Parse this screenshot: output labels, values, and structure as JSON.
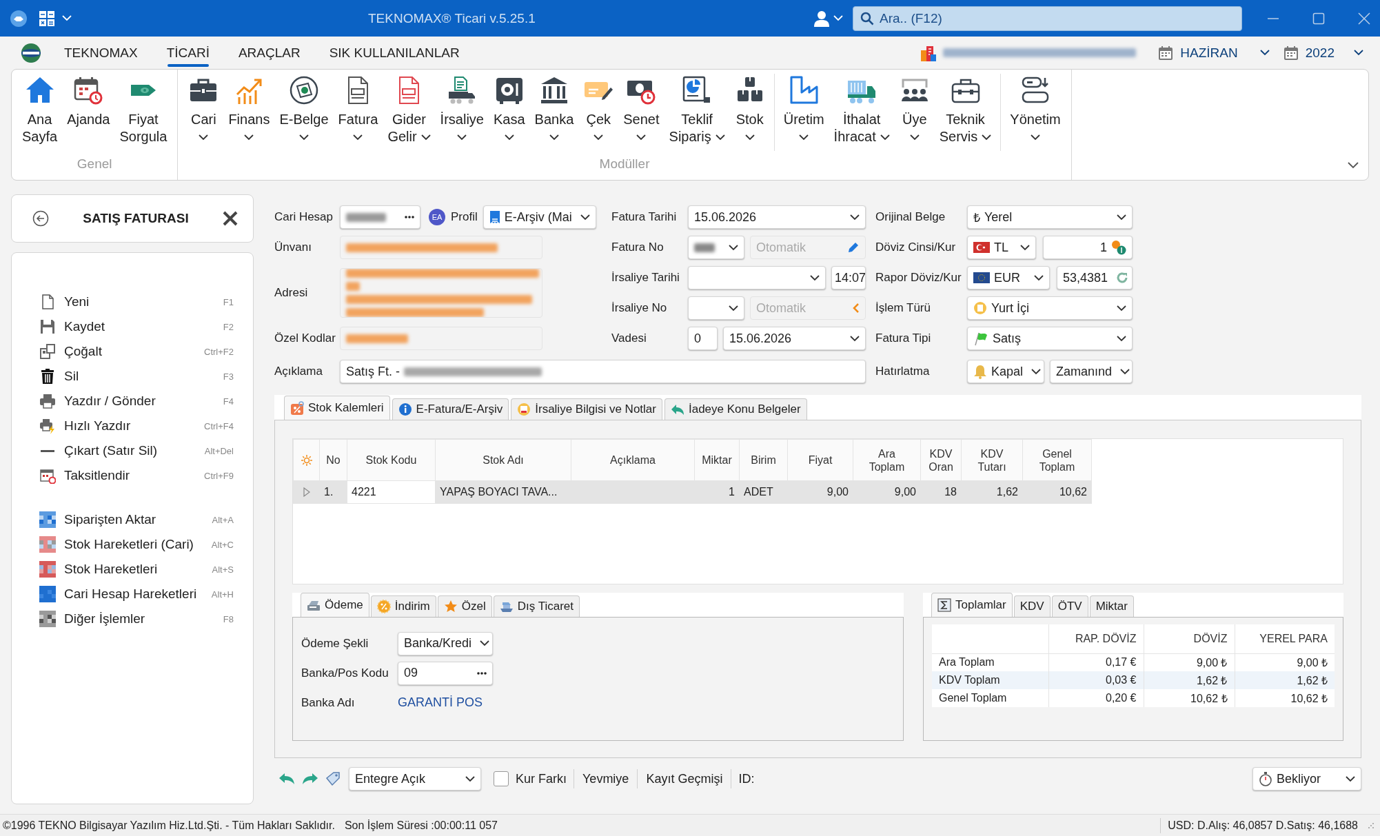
{
  "window": {
    "title": "TEKNOMAX® Ticari v.5.25.1",
    "search": {
      "placeholder": "Ara.. (F12)"
    }
  },
  "menu_tabs": [
    {
      "label": "TEKNOMAX",
      "selected": false
    },
    {
      "label": "TİCARİ",
      "selected": true
    },
    {
      "label": "ARAÇLAR",
      "selected": false
    },
    {
      "label": "SIK KULLANILANLAR",
      "selected": false
    }
  ],
  "period": {
    "company_blurred": true,
    "month": "HAZİRAN",
    "year": "2022"
  },
  "ribbon": [
    {
      "label": "Genel",
      "sections": [
        [
          {
            "label": "Ana\nSayfa",
            "dropdown": false
          },
          {
            "label": "Ajanda",
            "dropdown": false
          },
          {
            "label": "Fiyat\nSorgula",
            "dropdown": false
          }
        ]
      ]
    },
    {
      "label": "Modüller",
      "sections": [
        [
          {
            "label": "Cari",
            "dropdown": true
          },
          {
            "label": "Finans",
            "dropdown": true
          },
          {
            "label": "E-Belge",
            "dropdown": true
          },
          {
            "label": "Fatura",
            "dropdown": true
          },
          {
            "label": "Gider\nGelir",
            "dropdown": true
          },
          {
            "label": "İrsaliye",
            "dropdown": true
          },
          {
            "label": "Kasa",
            "dropdown": true
          },
          {
            "label": "Banka",
            "dropdown": true
          },
          {
            "label": "Çek",
            "dropdown": true
          },
          {
            "label": "Senet",
            "dropdown": true
          },
          {
            "label": "Teklif\nSipariş",
            "dropdown": true
          },
          {
            "label": "Stok",
            "dropdown": true
          }
        ],
        [
          {
            "label": "Üretim",
            "dropdown": true
          },
          {
            "label": "İthalat\nİhracat",
            "dropdown": true
          },
          {
            "label": "Üye",
            "dropdown": true
          },
          {
            "label": "Teknik\nServis",
            "dropdown": true
          }
        ],
        [
          {
            "label": "Yönetim",
            "dropdown": true
          }
        ]
      ]
    }
  ],
  "document": {
    "title": "SATIŞ FATURASI",
    "action_groups": [
      [
        {
          "label": "Yeni",
          "shortcut": "F1"
        },
        {
          "label": "Kaydet",
          "shortcut": "F2"
        },
        {
          "label": "Çoğalt",
          "shortcut": "Ctrl+F2"
        },
        {
          "label": "Sil",
          "shortcut": "F3"
        },
        {
          "label": "Yazdır / Gönder",
          "shortcut": "F4"
        },
        {
          "label": "Hızlı Yazdır",
          "shortcut": "Ctrl+F4"
        },
        {
          "label": "Çıkart (Satır Sil)",
          "shortcut": "Alt+Del"
        },
        {
          "label": "Taksitlendir",
          "shortcut": "Ctrl+F9"
        }
      ],
      [
        {
          "label": "Siparişten Aktar",
          "shortcut": "Alt+A"
        },
        {
          "label": "Stok Hareketleri (Cari)",
          "shortcut": "Alt+C"
        },
        {
          "label": "Stok Hareketleri",
          "shortcut": "Alt+S"
        },
        {
          "label": "Cari Hesap Hareketleri",
          "shortcut": "Alt+H"
        },
        {
          "label": "Diğer İşlemler",
          "shortcut": "F8"
        }
      ]
    ]
  },
  "form": {
    "cari_hesap": {
      "label": "Cari Hesap",
      "value_blurred": true
    },
    "profil": {
      "badge": "EA",
      "label": "Profil",
      "value": "E-Arşiv (Mai"
    },
    "unvani": {
      "label": "Ünvanı",
      "value_blurred": true
    },
    "adresi": {
      "label": "Adresi",
      "value_blurred": true
    },
    "ozel_kodlar": {
      "label": "Özel Kodlar",
      "value_blurred": true
    },
    "aciklama": {
      "label": "Açıklama",
      "value": "Satış Ft. -",
      "value_blurred": true
    },
    "fatura_tarihi": {
      "label": "Fatura Tarihi",
      "value": "15.06.2026"
    },
    "fatura_no": {
      "label": "Fatura No",
      "series_blurred": true,
      "number_placeholder": "Otomatik"
    },
    "irsaliye_tarihi": {
      "label": "İrsaliye Tarihi",
      "time": "14:07"
    },
    "irsaliye_no": {
      "label": "İrsaliye No",
      "number_placeholder": "Otomatik"
    },
    "vadesi": {
      "label": "Vadesi",
      "days": "0",
      "date": "15.06.2026"
    },
    "orijinal_belge": {
      "label": "Orijinal Belge",
      "symbol": "₺",
      "value": "Yerel"
    },
    "doviz": {
      "label": "Döviz Cinsi/Kur",
      "currency": "TL",
      "rate": "1"
    },
    "rapor_doviz": {
      "label": "Rapor Döviz/Kur",
      "currency": "EUR",
      "rate": "53,4381"
    },
    "islem_turu": {
      "label": "İşlem Türü",
      "value": "Yurt İçi"
    },
    "fatura_tipi": {
      "label": "Fatura Tipi",
      "value": "Satış"
    },
    "hatirlatma": {
      "label": "Hatırlatma",
      "value": "Kapal",
      "timing": "Zamanınd"
    }
  },
  "detail_tabs": [
    {
      "label": "Stok Kalemleri",
      "selected": true
    },
    {
      "label": "E-Fatura/E-Arşiv",
      "selected": false
    },
    {
      "label": "İrsaliye Bilgisi ve Notlar",
      "selected": false
    },
    {
      "label": "İadeye Konu Belgeler",
      "selected": false
    }
  ],
  "grid": {
    "columns": [
      "No",
      "Stok Kodu",
      "Stok Adı",
      "Açıklama",
      "Miktar",
      "Birim",
      "Fiyat",
      "Ara\nToplam",
      "KDV\nOran",
      "KDV\nTutarı",
      "Genel\nToplam"
    ],
    "rows": [
      {
        "selected": true,
        "cells": [
          "1.",
          "4221",
          "YAPAŞ BOYACI TAVA...",
          null,
          "1",
          "ADET",
          "9,00",
          "9,00",
          "18",
          "1,62",
          "10,62"
        ]
      }
    ]
  },
  "payment": {
    "tabs": [
      {
        "label": "Ödeme",
        "selected": true
      },
      {
        "label": "İndirim",
        "selected": false
      },
      {
        "label": "Özel",
        "selected": false
      },
      {
        "label": "Dış Ticaret",
        "selected": false
      }
    ],
    "odeme_sekli": {
      "label": "Ödeme Şekli",
      "value": "Banka/Kredi"
    },
    "banka_pos_kodu": {
      "label": "Banka/Pos Kodu",
      "value": "09"
    },
    "banka_adi": {
      "label": "Banka Adı",
      "value": "GARANTİ POS"
    }
  },
  "totals": {
    "tabs": [
      {
        "label": "Toplamlar",
        "selected": true
      },
      {
        "label": "KDV",
        "selected": false
      },
      {
        "label": "ÖTV",
        "selected": false
      },
      {
        "label": "Miktar",
        "selected": false
      }
    ],
    "columns": [
      "RAP. DÖVİZ",
      "DÖVİZ",
      "YEREL PARA"
    ],
    "rows": [
      {
        "label": "Ara Toplam",
        "values": [
          "0,17 €",
          "9,00 ₺",
          "9,00 ₺"
        ]
      },
      {
        "label": "KDV Toplam",
        "values": [
          "0,03 €",
          "1,62 ₺",
          "1,62 ₺"
        ]
      },
      {
        "label": "Genel Toplam",
        "values": [
          "0,20 €",
          "10,62 ₺",
          "10,62 ₺"
        ]
      }
    ]
  },
  "action_bar": {
    "integration": "Entegre Açık",
    "kur_farki": {
      "label": "Kur Farkı",
      "checked": false
    },
    "links": [
      "Yevmiye",
      "Kayıt Geçmişi"
    ],
    "id_label": "ID:",
    "status": "Bekliyor"
  },
  "status_bar": {
    "copyright": "©1996 TEKNO Bilgisayar Yazılım Hiz.Ltd.Şti. - Tüm Hakları Saklıdır.",
    "last_operation": "Son İşlem Süresi :00:00:11 057",
    "rates": "USD: D.Alış:  46,0857 D.Satış:  46,1688"
  }
}
